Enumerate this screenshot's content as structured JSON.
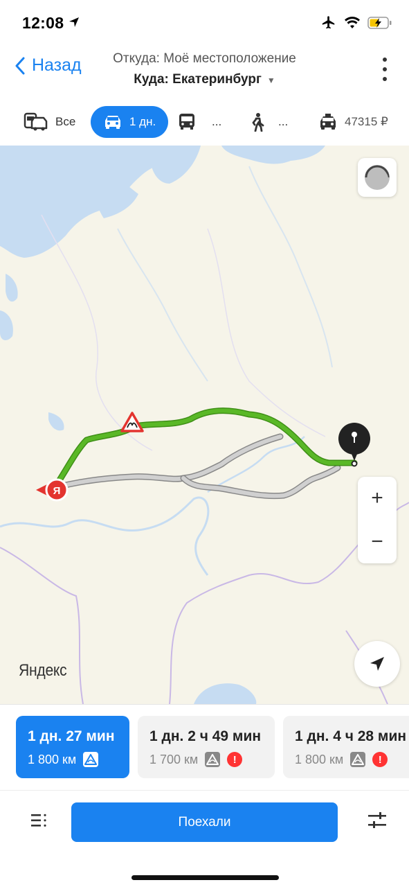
{
  "status_bar": {
    "time": "12:08"
  },
  "header": {
    "back_label": "Назад",
    "from": "Откуда: Моё местоположение",
    "to": "Куда: Екатеринбург"
  },
  "transport_tabs": [
    {
      "icon": "car-bus-icon",
      "label": "Все",
      "active": false
    },
    {
      "icon": "car-icon",
      "label": "1 дн.",
      "active": true
    },
    {
      "icon": "bus-icon",
      "label": "...",
      "active": false
    },
    {
      "icon": "pedestrian-icon",
      "label": "...",
      "active": false
    },
    {
      "icon": "taxi-icon",
      "label": "47315 ₽",
      "active": false
    }
  ],
  "map": {
    "watermark": "Яндекс",
    "start_marker": "Я",
    "zoom_in": "+",
    "zoom_out": "−",
    "colors": {
      "active_route": "#5ab827",
      "alt_route": "#bdbdbd",
      "water": "#c6dcf2",
      "land": "#f6f4e9"
    }
  },
  "routes": [
    {
      "time": "1 дн. 27 мин",
      "distance": "1 800 км",
      "selected": true,
      "warning": false
    },
    {
      "time": "1 дн. 2 ч 49 мин",
      "distance": "1 700 км",
      "selected": false,
      "warning": true,
      "warning_label": "!"
    },
    {
      "time": "1 дн. 4 ч 28 мин",
      "distance": "1 800 км",
      "selected": false,
      "warning": true,
      "warning_label": "!"
    }
  ],
  "bottom": {
    "go_label": "Поехали"
  },
  "accent_color": "#1a82f0"
}
